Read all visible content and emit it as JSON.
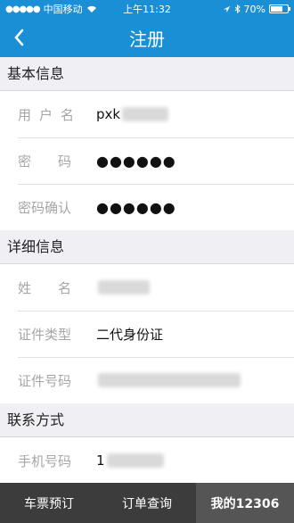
{
  "status_bar": {
    "carrier": "中国移动",
    "time": "上午11:32",
    "battery_percent": "70%",
    "battery_level": 0.7
  },
  "nav": {
    "title": "注册"
  },
  "sections": {
    "basic": {
      "title": "基本信息",
      "username_label": "用户名",
      "username_value": "pxk",
      "password_label": "密码",
      "password_value": "●●●●●●",
      "confirm_label": "密码确认",
      "confirm_value": "●●●●●●"
    },
    "detail": {
      "title": "详细信息",
      "name_label": "姓名",
      "name_value": "",
      "id_type_label": "证件类型",
      "id_type_value": "二代身份证",
      "id_number_label": "证件号码",
      "id_number_value": ""
    },
    "contact": {
      "title": "联系方式",
      "phone_label": "手机号码",
      "phone_value": "1"
    }
  },
  "tabs": [
    {
      "label": "车票预订"
    },
    {
      "label": "订单查询"
    },
    {
      "label": "我的12306"
    }
  ],
  "colors": {
    "accent": "#1a8fd6",
    "tab_bar": "#3c3c3c",
    "tab_active": "#555555"
  }
}
